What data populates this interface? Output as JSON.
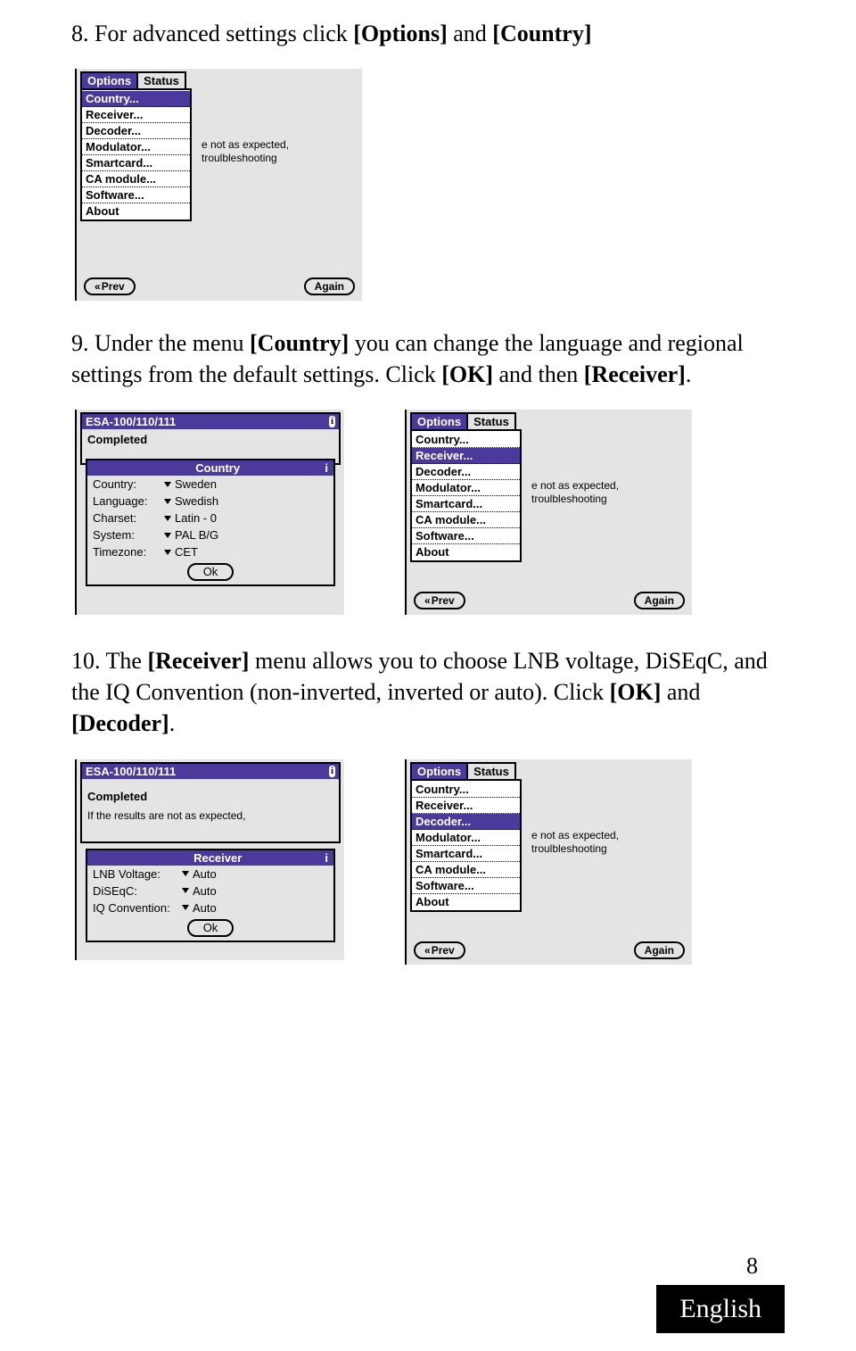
{
  "para1": {
    "prefix": "8. For advanced settings click ",
    "b1": "[Options]",
    "mid": " and ",
    "b2": "[Country]"
  },
  "para2": {
    "prefix": "9. Under the menu ",
    "b1": "[Country]",
    "mid1": " you can change the language and regional settings from the default settings. Click ",
    "b2": "[OK]",
    "mid2": " and then ",
    "b3": "[Receiver]",
    "suffix": "."
  },
  "para3": {
    "prefix": "10. The ",
    "b1": "[Receiver]",
    "mid1": " menu allows you to choose LNB voltage, DiSEqC, and the IQ Convention (non-inverted, inverted or auto). Click ",
    "b2": "[OK]",
    "mid2": " and ",
    "b3": "[Decoder]",
    "suffix": "."
  },
  "common": {
    "tab_options": "Options",
    "tab_status": "Status",
    "menu_items": [
      "Country...",
      "Receiver...",
      "Decoder...",
      "Modulator...",
      "Smartcard...",
      "CA module...",
      "Software...",
      "About"
    ],
    "btn_prev": "Prev",
    "btn_again": "Again",
    "bg_line1": "e not as expected,",
    "bg_line2": "troulbleshooting",
    "info_icon": "i"
  },
  "shot1": {
    "sel_index": 0
  },
  "shot2a": {
    "title": "ESA-100/110/111",
    "completed": "Completed",
    "dlg_title": "Country",
    "rows": [
      {
        "label": "Country:",
        "value": "Sweden"
      },
      {
        "label": "Language:",
        "value": "Swedish"
      },
      {
        "label": "Charset:",
        "value": "Latin - 0"
      },
      {
        "label": "System:",
        "value": "PAL B/G"
      },
      {
        "label": "Timezone:",
        "value": "CET"
      }
    ],
    "ok": "Ok"
  },
  "shot2b": {
    "sel_index": 1
  },
  "shot3a": {
    "title": "ESA-100/110/111",
    "completed": "Completed",
    "sub": "If the results are not as expected,",
    "dlg_title": "Receiver",
    "rows": [
      {
        "label": "LNB Voltage:",
        "value": "Auto"
      },
      {
        "label": "DiSEqC:",
        "value": "Auto"
      },
      {
        "label": "IQ Convention:",
        "value": "Auto"
      }
    ],
    "ok": "Ok"
  },
  "shot3b": {
    "sel_index": 2
  },
  "footer": {
    "page": "8",
    "lang": "English"
  }
}
